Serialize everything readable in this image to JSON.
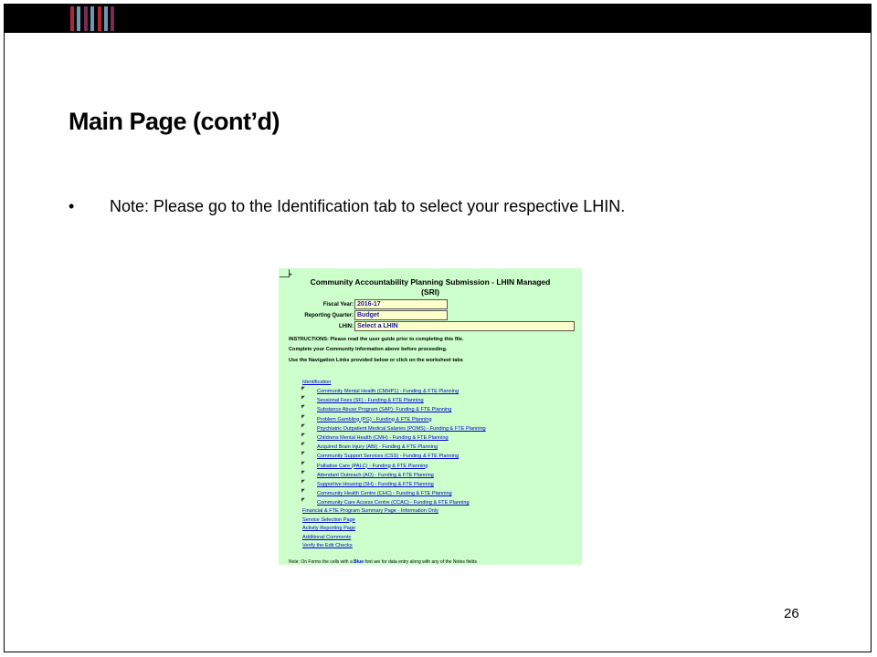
{
  "slide": {
    "title": "Main Page (cont’d)",
    "bullet_symbol": "•",
    "bullet_text": "Note: Please go to the Identification tab to select your respective LHIN.",
    "page_number": "26"
  },
  "decor": {
    "stripe_colors": [
      "#b0243c",
      "#6d98b3",
      "#7a2a55",
      "#6d98b3",
      "#b0243c",
      "#6d98b3",
      "#7a2a55"
    ]
  },
  "sheet": {
    "title_line1": "Community Accountability Planning Submission - LHIN Managed",
    "title_line2": "(SRI)",
    "fields": {
      "fiscal_year_label": "Fiscal Year:",
      "fiscal_year_value": "2016-17",
      "reporting_quarter_label": "Reporting Quarter:",
      "reporting_quarter_value": "Budget",
      "lhin_label": "LHIN:",
      "lhin_value": "Select a LHIN"
    },
    "instructions": [
      "INSTRUCTIONS:  Please read the user guide prior to completing this file.",
      "Complete your Community Information above before proceeding.",
      "Use the Navigation Links provided below or click on the worksheet tabs"
    ],
    "nav_top": "Identification",
    "nav_sub": [
      "Community Mental Health (CMHP1) - Funding & FTE Planning",
      "Sessional Fees (SF) - Funding & FTE Planning",
      "Substance Abuse Program (SAP)-  Funding & FTE Planning",
      "Problem Gambling (PG) - Funding & FTE Planning",
      "Psychiatric Outpatient Medical Salaries (POMS) - Funding & FTE Planning",
      "Childrens Mental Health (CMH) - Funding & FTE Planning",
      "Acquired Brain Injury (ABI) -  Funding & FTE Planning",
      "Community Support Services (CSS) -  Funding & FTE Planning",
      "Palliative Care (PALC) -  Funding & FTE Planning",
      "Attendant Outreach (AO) -  Funding & FTE Planning",
      "Supportive Housing (SH) -  Funding & FTE Planning",
      "Community Health Centre (CHC) -  Funding & FTE Planning",
      "Community Care Access Centre (CCAC) - Funding & FTE Planning"
    ],
    "nav_bottom": [
      "Financial & FTE Program Summary Page - Information Only",
      "Service Selection Page",
      "Activity Reporting Page",
      "Additional Comments",
      "Verify the Edit Checks"
    ],
    "note_prefix": "Note:  On Forms the cells with a ",
    "note_blue": "Blue",
    "note_suffix": " font are for data entry along with any of the Notes fields"
  }
}
